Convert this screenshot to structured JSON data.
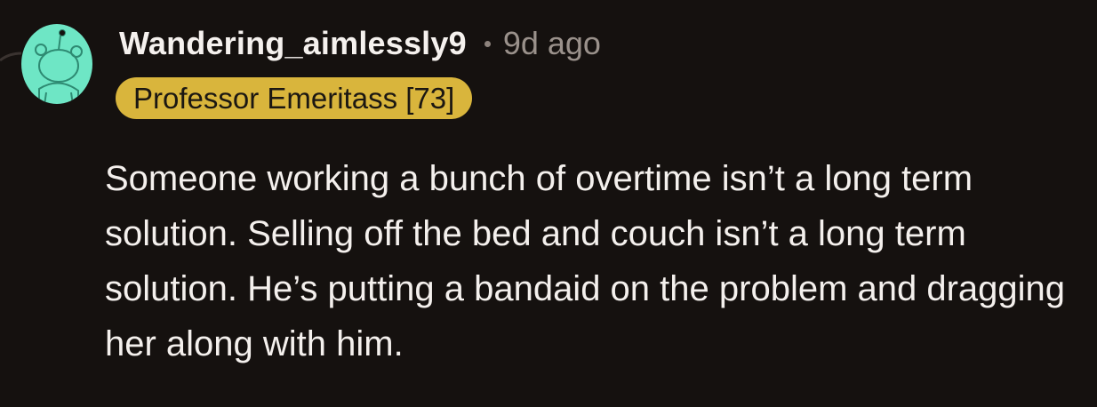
{
  "comment": {
    "username": "Wandering_aimlessly9",
    "timestamp": "9d ago",
    "flair": "Professor Emeritass [73]",
    "body": "Someone working a bunch of overtime isn’t a long term solution. Selling off the bed and couch isn’t a long term solution. He’s putting a bandaid on the problem and dragging her along with him."
  },
  "colors": {
    "background": "#15110f",
    "flair_bg": "#d9b53c",
    "avatar_bg": "#6ee6c5",
    "muted_text": "#9a918b"
  },
  "icons": {
    "avatar": "snoo-avatar-icon"
  }
}
